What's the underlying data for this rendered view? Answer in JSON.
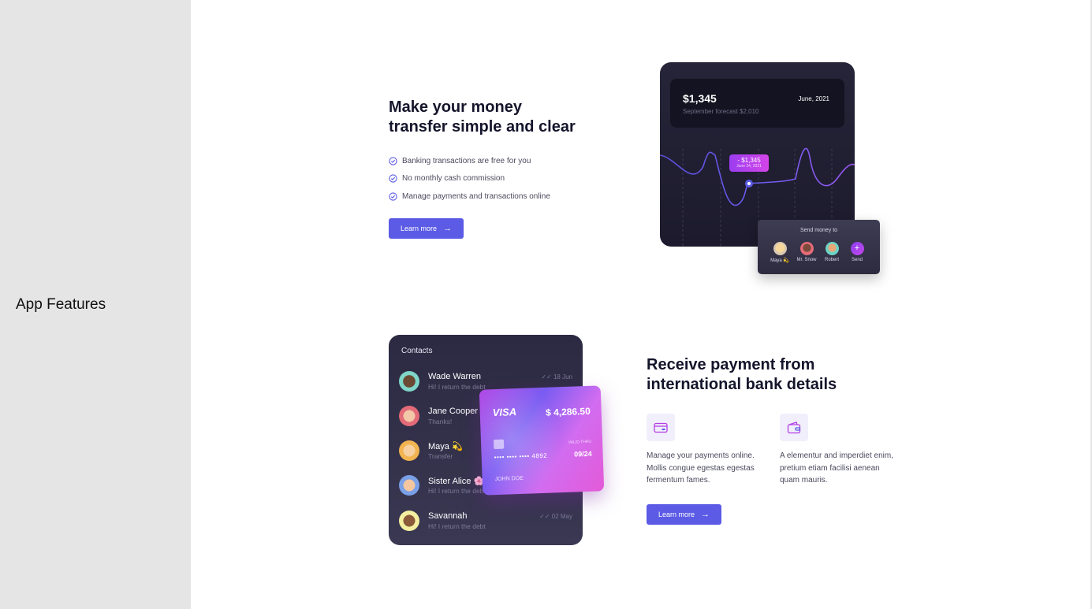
{
  "sidebar": {
    "title": "App Features"
  },
  "section1": {
    "heading_line1": "Make your money",
    "heading_line2": "transfer simple and clear",
    "features": [
      "Banking transactions are free for you",
      "No monthly cash commission",
      "Manage payments and transactions online"
    ],
    "button_label": "Learn more"
  },
  "chart_card": {
    "amount": "$1,345",
    "date": "June, 2021",
    "forecast": "September forecast $2,010",
    "tooltip_value": "- $1,345",
    "tooltip_date": "June 24, 2021"
  },
  "send_card": {
    "title": "Send money to",
    "recipients": [
      "Maya 💫",
      "Mr. Snow",
      "Robert"
    ],
    "send_label": "Send"
  },
  "contacts": {
    "title": "Contacts",
    "items": [
      {
        "name": "Wade Warren",
        "message": "Hi! I return the debt",
        "date": "18 Jun"
      },
      {
        "name": "Jane Cooper",
        "message": "Thanks!",
        "date": ""
      },
      {
        "name": "Maya 💫",
        "message": "Transfer",
        "date": ""
      },
      {
        "name": "Sister Alice 🌸",
        "message": "Hi! I return the debt",
        "date": ""
      },
      {
        "name": "Savannah",
        "message": "Hi! I return the debt",
        "date": "02 May"
      }
    ]
  },
  "visa_card": {
    "brand": "VISA",
    "balance": "$ 4,286.50",
    "number": "•••• •••• •••• 4892",
    "valid_label": "VALID THRU",
    "expiry": "09/24",
    "holder": "JOHN DOE"
  },
  "section2": {
    "heading_line1": "Receive payment from",
    "heading_line2": "international bank details",
    "feature1_text": "Manage your payments online. Mollis congue egestas egestas fermentum fames.",
    "feature2_text": "A elementur and imperdiet enim, pretium etiam facilisi aenean quam mauris.",
    "button_label": "Learn more",
    "feature1_icon": "credit-card-icon",
    "feature2_icon": "wallet-icon"
  },
  "colors": {
    "accent": "#5b5be6",
    "sidebar_bg": "#e5e5e5",
    "card_dark": "#262438",
    "heading": "#14142b"
  }
}
